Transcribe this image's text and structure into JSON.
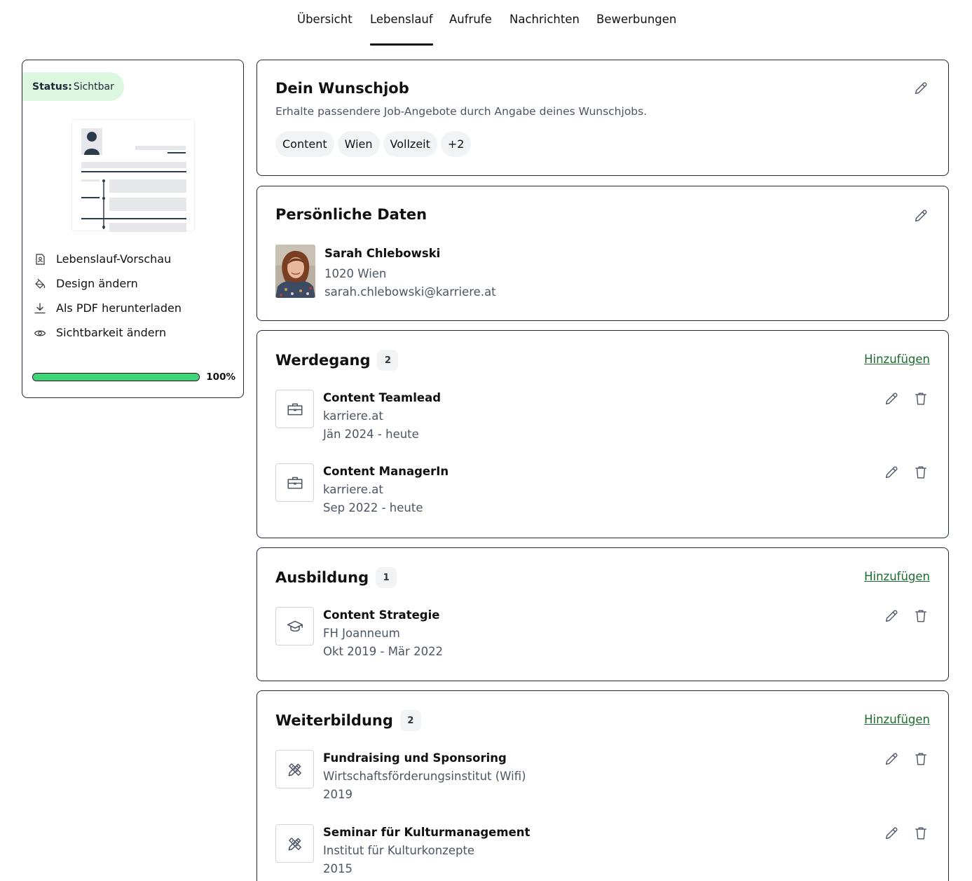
{
  "nav": {
    "tabs": [
      {
        "label": "Übersicht",
        "active": false
      },
      {
        "label": "Lebenslauf",
        "active": true
      },
      {
        "label": "Aufrufe",
        "active": false
      },
      {
        "label": "Nachrichten",
        "active": false
      },
      {
        "label": "Bewerbungen",
        "active": false
      }
    ]
  },
  "sidebar": {
    "status_label": "Status:",
    "status_value": "Sichtbar",
    "menu": [
      {
        "label": "Lebenslauf-Vorschau",
        "icon": "cv-preview-icon"
      },
      {
        "label": "Design ändern",
        "icon": "paint-bucket-icon"
      },
      {
        "label": "Als PDF herunterladen",
        "icon": "download-icon"
      },
      {
        "label": "Sichtbarkeit ändern",
        "icon": "eye-icon"
      }
    ],
    "progress_percent": 100,
    "progress_label": "100%",
    "colors": {
      "status_bg": "#dcf7df",
      "progress_fill": "#3dd47a"
    }
  },
  "wunschjob": {
    "title": "Dein Wunschjob",
    "subtitle": "Erhalte passendere Job-Angebote durch Angabe deines Wunschjobs.",
    "chips": [
      "Content",
      "Wien",
      "Vollzeit",
      "+2"
    ]
  },
  "personal": {
    "title": "Persönliche Daten",
    "name": "Sarah Chlebowski",
    "location": "1020 Wien",
    "email": "sarah.chlebowski@karriere.at"
  },
  "werdegang": {
    "title": "Werdegang",
    "count": "2",
    "add_label": "Hinzufügen",
    "entries": [
      {
        "title": "Content Teamlead",
        "org": "karriere.at",
        "date": "Jän 2024 - heute",
        "icon": "briefcase-icon"
      },
      {
        "title": "Content ManagerIn",
        "org": "karriere.at",
        "date": "Sep 2022 - heute",
        "icon": "briefcase-icon"
      }
    ]
  },
  "ausbildung": {
    "title": "Ausbildung",
    "count": "1",
    "add_label": "Hinzufügen",
    "entries": [
      {
        "title": "Content Strategie",
        "org": "FH Joanneum",
        "date": "Okt 2019 - Mär 2022",
        "icon": "graduation-cap-icon"
      }
    ]
  },
  "weiterbildung": {
    "title": "Weiterbildung",
    "count": "2",
    "add_label": "Hinzufügen",
    "entries": [
      {
        "title": "Fundraising und Sponsoring",
        "org": "Wirtschaftsförderungsinstitut (Wifi)",
        "date": "2019",
        "icon": "pencil-ruler-icon"
      },
      {
        "title": "Seminar für Kulturmanagement",
        "org": "Institut für Kulturkonzepte",
        "date": "2015",
        "icon": "pencil-ruler-icon"
      }
    ]
  },
  "colors": {
    "link_green": "#1c6b2f",
    "border": "#1f2937",
    "muted_text": "#4b5563"
  }
}
